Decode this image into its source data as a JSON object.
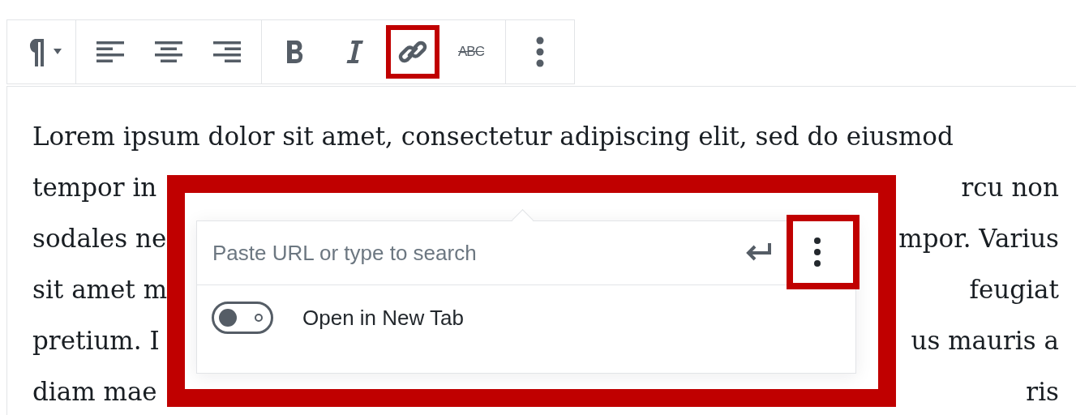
{
  "toolbar": {
    "groups": [
      [
        {
          "kind": "paragraph",
          "annotated": false
        }
      ],
      [
        {
          "kind": "align-left",
          "annotated": false
        },
        {
          "kind": "align-center",
          "annotated": false
        },
        {
          "kind": "align-right",
          "annotated": false
        }
      ],
      [
        {
          "kind": "bold",
          "annotated": false
        },
        {
          "kind": "italic",
          "annotated": false
        },
        {
          "kind": "link",
          "annotated": true
        },
        {
          "kind": "strikethrough",
          "label": "ABC",
          "annotated": false
        }
      ],
      [
        {
          "kind": "more",
          "annotated": false
        }
      ]
    ]
  },
  "paragraph": [
    {
      "kind": "full",
      "text": "Lorem ipsum dolor sit amet, consectetur adipiscing elit, sed do eiusmod"
    },
    {
      "kind": "split",
      "left": "tempor in",
      "right": "rcu non"
    },
    {
      "kind": "split",
      "left": "sodales ne",
      "right": "mpor. Varius"
    },
    {
      "kind": "split",
      "left": "sit amet m",
      "right": "feugiat"
    },
    {
      "kind": "split",
      "left": "pretium. I",
      "right": "us mauris a"
    },
    {
      "kind": "split",
      "left": "diam mae",
      "right": "ris"
    }
  ],
  "link_popover": {
    "annotated": true,
    "url_field": {
      "placeholder": "Paste URL or type to search"
    },
    "more_button": {
      "annotated": true
    },
    "toggle": {
      "label": "Open in New Tab",
      "on": false
    }
  }
}
